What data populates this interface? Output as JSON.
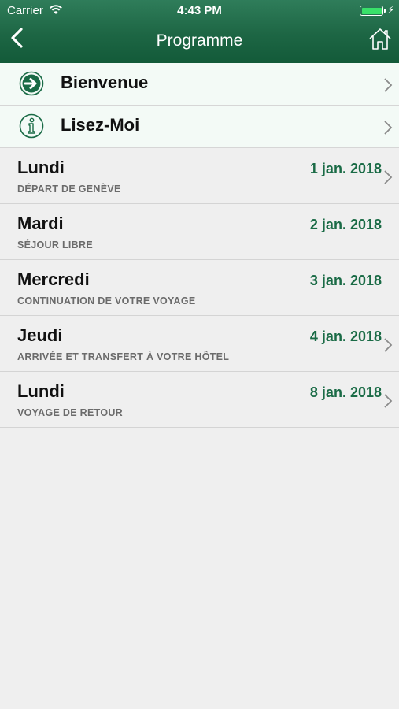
{
  "status_bar": {
    "carrier": "Carrier",
    "time": "4:43 PM",
    "battery_level": 1.0
  },
  "nav": {
    "title": "Programme",
    "back_icon": "chevron-left-icon",
    "home_icon": "home-icon"
  },
  "menu": [
    {
      "label": "Bienvenue",
      "icon": "arrow-right-circle-icon"
    },
    {
      "label": "Lisez-Moi",
      "icon": "info-circle-icon"
    }
  ],
  "days": [
    {
      "name": "Lundi",
      "date": "1 jan. 2018",
      "desc": "DÉPART DE GENÈVE",
      "has_chevron": true
    },
    {
      "name": "Mardi",
      "date": "2 jan. 2018",
      "desc": "SÉJOUR LIBRE",
      "has_chevron": false
    },
    {
      "name": "Mercredi",
      "date": "3 jan. 2018",
      "desc": "CONTINUATION DE VOTRE VOYAGE",
      "has_chevron": false
    },
    {
      "name": "Jeudi",
      "date": "4 jan. 2018",
      "desc": "ARRIVÉE ET TRANSFERT À VOTRE HÔTEL",
      "has_chevron": true
    },
    {
      "name": "Lundi",
      "date": "8 jan. 2018",
      "desc": "VOYAGE DE RETOUR",
      "has_chevron": true
    }
  ],
  "colors": {
    "accent": "#1a6b46",
    "header": "#1d6644",
    "menu_bg": "#f3faf6",
    "page_bg": "#efefef"
  }
}
